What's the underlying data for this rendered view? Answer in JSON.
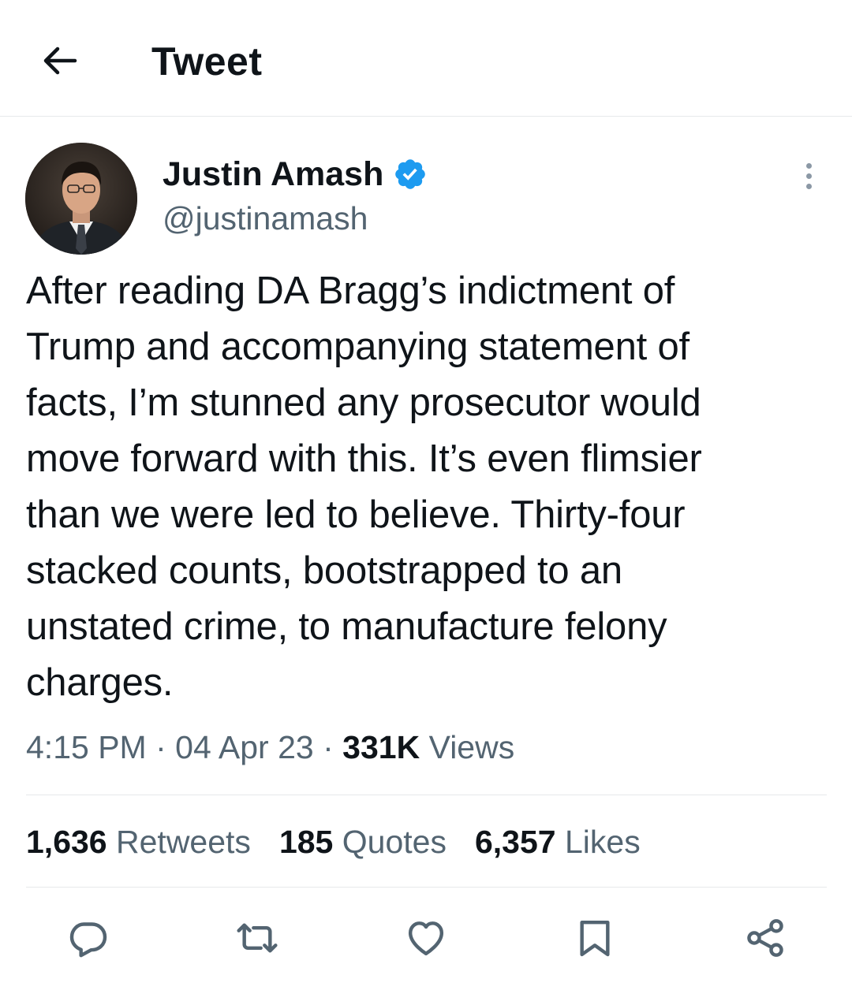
{
  "header": {
    "title": "Tweet",
    "back_icon": "arrow-left-icon"
  },
  "author": {
    "name": "Justin Amash",
    "handle": "@justinamash",
    "verified": true,
    "verified_color": "#1d9bf0"
  },
  "tweet": {
    "text": "After reading DA Bragg’s indictment of\nTrump and accompanying statement of\nfacts, I’m stunned any prosecutor would\nmove forward with this. It’s even flimsier\nthan we were led to believe. Thirty-four\nstacked counts, bootstrapped to an\nunstated crime, to manufacture felony\ncharges.",
    "time": "4:15 PM",
    "separator": "·",
    "date": "04 Apr 23",
    "views_count": "331K",
    "views_label": "Views"
  },
  "stats": {
    "retweets_count": "1,636",
    "retweets_label": "Retweets",
    "quotes_count": "185",
    "quotes_label": "Quotes",
    "likes_count": "6,357",
    "likes_label": "Likes"
  },
  "actions": [
    "reply-icon",
    "retweet-icon",
    "like-icon",
    "bookmark-icon",
    "share-icon"
  ],
  "colors": {
    "text_primary": "#0f1419",
    "text_secondary": "#536471",
    "divider": "#e6e9eb"
  }
}
